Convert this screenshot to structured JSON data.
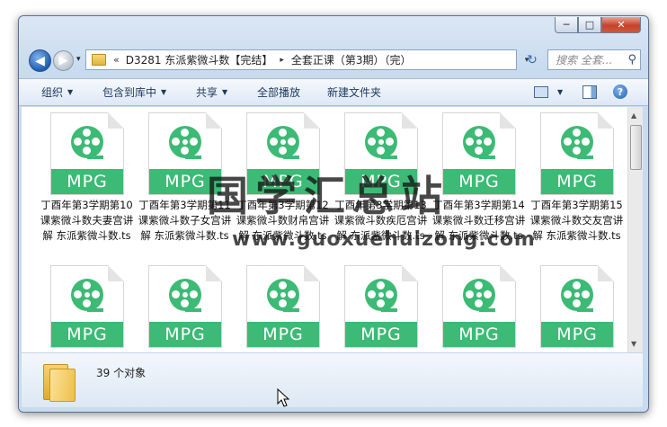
{
  "window": {
    "caption_buttons": [
      "─",
      "□",
      "✕"
    ]
  },
  "nav": {
    "back_glyph": "◀",
    "forward_glyph": "▶",
    "dropdown_glyph": "▾"
  },
  "address": {
    "history_chevron": "«",
    "parts": [
      "D3281 东派紫微斗数【完结】",
      "全套正课（第3期）（完）"
    ],
    "separator": "▸",
    "dropdown_glyph": "▾",
    "refresh_glyph": "↻"
  },
  "search": {
    "placeholder": "搜索 全套...",
    "icon": "search-icon"
  },
  "toolbar": {
    "organize": "组织",
    "include_library": "包含到库中",
    "share": "共享",
    "play_all": "全部播放",
    "new_folder": "新建文件夹",
    "view_icon": "view-icon",
    "preview_icon": "preview-pane-icon",
    "help_glyph": "?"
  },
  "files": [
    {
      "name": "丁酉年第3学期第10课紫微斗数夫妻宫讲解  东派紫微斗数.ts",
      "badge": "MPG"
    },
    {
      "name": "丁酉年第3学期第11课紫微斗数子女宫讲解  东派紫微斗数.ts",
      "badge": "MPG"
    },
    {
      "name": "丁酉年第3学期第12课紫微斗数财帛宫讲解  东派紫微斗数.ts",
      "badge": "MPG"
    },
    {
      "name": "丁酉年第3学期第13课紫微斗数疾厄宫讲解  东派紫微斗数.ts",
      "badge": "MPG"
    },
    {
      "name": "丁酉年第3学期第14课紫微斗数迁移宫讲解  东派紫微斗数.ts",
      "badge": "MPG"
    },
    {
      "name": "丁酉年第3学期第15课紫微斗数交友宫讲解  东派紫微斗数.ts",
      "badge": "MPG"
    },
    {
      "name": "",
      "badge": "MPG"
    },
    {
      "name": "",
      "badge": "MPG"
    },
    {
      "name": "",
      "badge": "MPG"
    },
    {
      "name": "",
      "badge": "MPG"
    },
    {
      "name": "",
      "badge": "MPG"
    },
    {
      "name": "",
      "badge": "MPG"
    }
  ],
  "status": {
    "count_text": "39 个对象"
  },
  "watermark": {
    "title": "国学汇总站",
    "url": "www.guoxuehuizong.com"
  },
  "colors": {
    "file_green": "#3dba75",
    "window_blue": "#c8dbef"
  }
}
